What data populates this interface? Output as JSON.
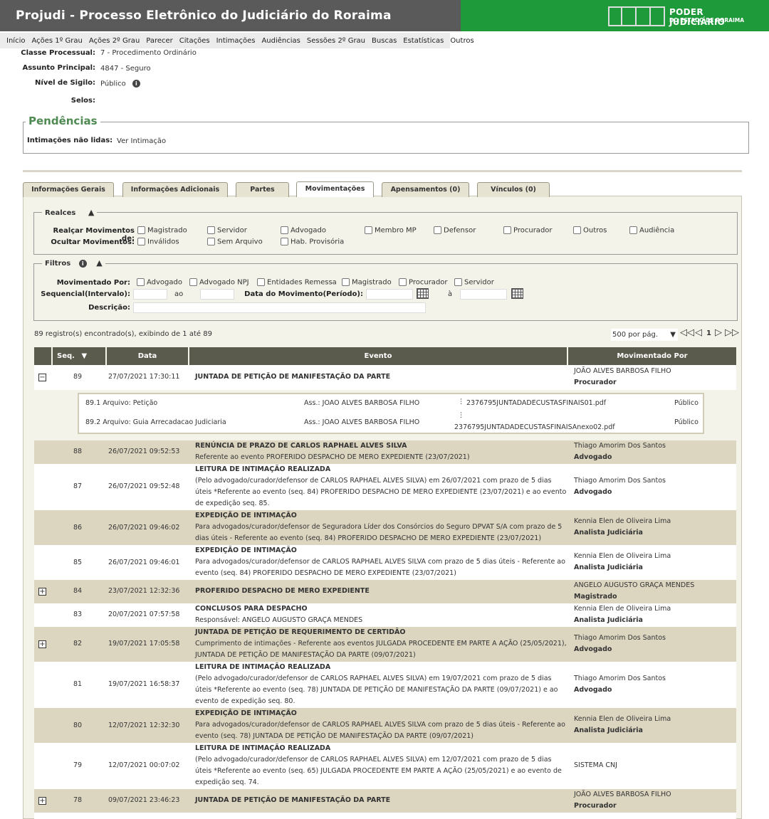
{
  "header": {
    "title": "Projudi - Processo Eletrônico do Judiciário do Roraima",
    "logo_line1": "PODER JUDICIÁRIO",
    "logo_line2": "DO ESTADO DE RORAIMA"
  },
  "menu": [
    "Início",
    "Ações 1º Grau",
    "Ações 2º Grau",
    "Parecer",
    "Citações",
    "Intimações",
    "Audiências",
    "Sessões 2º Grau",
    "Buscas",
    "Estatísticas",
    "Outros"
  ],
  "info": {
    "classe_label": "Classe Processual:",
    "classe_value": "7 - Procedimento Ordinário",
    "assunto_label": "Assunto Principal:",
    "assunto_value": "4847 - Seguro",
    "sigilo_label": "Nível de Sigilo:",
    "sigilo_value": "Público",
    "selos_label": "Selos:"
  },
  "pendencias": {
    "title": "Pendências",
    "label": "Intimações não lidas:",
    "link_ver": "Ver",
    "link_text": "Intimação"
  },
  "tabs": [
    "Informações Gerais",
    "Informações Adicionais",
    "Partes",
    "Movimentações",
    "Apensamentos (0)",
    "Vínculos (0)"
  ],
  "realces": {
    "legend": "Realces",
    "realcar_label": "Realçar Movimentos de:",
    "realcar_options": [
      "Magistrado",
      "Servidor",
      "Advogado",
      "Membro MP",
      "Defensor",
      "Procurador",
      "Outros",
      "Audiência"
    ],
    "ocultar_label": "Ocultar Movimentos:",
    "ocultar_options": [
      "Inválidos",
      "Sem Arquivo",
      "Hab. Provisória"
    ]
  },
  "filtros": {
    "legend": "Filtros",
    "mov_por_label": "Movimentado Por:",
    "mov_por_options": [
      "Advogado",
      "Advogado NPJ",
      "Entidades Remessa",
      "Magistrado",
      "Procurador",
      "Servidor"
    ],
    "seq_label": "Sequencial(Intervalo):",
    "ao": "ao",
    "data_label": "Data do Movimento(Período):",
    "a": "à",
    "descricao_label": "Descrição:"
  },
  "results": {
    "summary": "89 registro(s) encontrado(s), exibindo de 1 até 89",
    "per_page": "500 por pág.",
    "page": "1"
  },
  "table": {
    "headers": [
      "Seq.",
      "Data",
      "Evento",
      "Movimentado Por"
    ],
    "rows": [
      {
        "seq": "89",
        "date": "27/07/2021 17:30:11",
        "title": "JUNTADA DE PETIÇÃO DE MANIFESTAÇÃO DA PARTE",
        "desc": "",
        "by": "JOÃO ALVES BARBOSA FILHO",
        "role": "Procurador"
      },
      {
        "seq": "88",
        "date": "26/07/2021 09:52:53",
        "title": "RENÚNCIA DE PRAZO DE CARLOS RAPHAEL ALVES SILVA",
        "desc": "Referente ao evento PROFERIDO DESPACHO DE MERO EXPEDIENTE (23/07/2021)",
        "by": "Thiago Amorim Dos Santos",
        "role": "Advogado"
      },
      {
        "seq": "87",
        "date": "26/07/2021 09:52:48",
        "title": "LEITURA DE INTIMAÇÃO REALIZADA",
        "desc": "(Pelo advogado/curador/defensor de CARLOS RAPHAEL ALVES SILVA) em 26/07/2021 com prazo de 5 dias úteis *Referente ao evento (seq. 84) PROFERIDO DESPACHO DE MERO EXPEDIENTE (23/07/2021) e ao evento de expedição seq. 85.",
        "by": "Thiago Amorim Dos Santos",
        "role": "Advogado"
      },
      {
        "seq": "86",
        "date": "26/07/2021 09:46:02",
        "title": "EXPEDIÇÃO DE INTIMAÇÃO",
        "desc": "Para advogados/curador/defensor de Seguradora Líder dos Consórcios do Seguro DPVAT S/A com prazo de 5 dias úteis - Referente ao evento (seq. 84) PROFERIDO DESPACHO DE MERO EXPEDIENTE (23/07/2021)",
        "by": "Kennia Elen de Oliveira Lima",
        "role": "Analista Judiciária"
      },
      {
        "seq": "85",
        "date": "26/07/2021 09:46:01",
        "title": "EXPEDIÇÃO DE INTIMAÇÃO",
        "desc": "Para advogados/curador/defensor de CARLOS RAPHAEL ALVES SILVA com prazo de 5 dias úteis - Referente ao evento (seq. 84) PROFERIDO DESPACHO DE MERO EXPEDIENTE (23/07/2021)",
        "by": "Kennia Elen de Oliveira Lima",
        "role": "Analista Judiciária"
      },
      {
        "seq": "84",
        "date": "23/07/2021 12:32:36",
        "title": "PROFERIDO DESPACHO DE MERO EXPEDIENTE",
        "desc": "",
        "by": "ANGELO AUGUSTO GRAÇA MENDES",
        "role": "Magistrado"
      },
      {
        "seq": "83",
        "date": "20/07/2021 07:57:58",
        "title": "CONCLUSOS PARA DESPACHO",
        "desc": "Responsável: ANGELO AUGUSTO GRAÇA MENDES",
        "by": "Kennia Elen de Oliveira Lima",
        "role": "Analista Judiciária"
      },
      {
        "seq": "82",
        "date": "19/07/2021 17:05:58",
        "title": "JUNTADA DE PETIÇÃO DE REQUERIMENTO DE CERTIDÃO",
        "desc": "Cumprimento de intimações - Referente aos eventos JULGADA PROCEDENTE EM PARTE A AÇÃO (25/05/2021), JUNTADA DE PETIÇÃO DE MANIFESTAÇÃO DA PARTE (09/07/2021)",
        "by": "Thiago Amorim Dos Santos",
        "role": "Advogado"
      },
      {
        "seq": "81",
        "date": "19/07/2021 16:58:37",
        "title": "LEITURA DE INTIMAÇÃO REALIZADA",
        "desc": "(Pelo advogado/curador/defensor de CARLOS RAPHAEL ALVES SILVA) em 19/07/2021 com prazo de 5 dias úteis *Referente ao evento (seq. 78) JUNTADA DE PETIÇÃO DE MANIFESTAÇÃO DA PARTE (09/07/2021) e ao evento de expedição seq. 80.",
        "by": "Thiago Amorim Dos Santos",
        "role": "Advogado"
      },
      {
        "seq": "80",
        "date": "12/07/2021 12:32:30",
        "title": "EXPEDIÇÃO DE INTIMAÇÃO",
        "desc": "Para advogados/curador/defensor de CARLOS RAPHAEL ALVES SILVA com prazo de 5 dias úteis - Referente ao evento (seq. 78) JUNTADA DE PETIÇÃO DE MANIFESTAÇÃO DA PARTE (09/07/2021)",
        "by": "Kennia Elen de Oliveira Lima",
        "role": "Analista Judiciária"
      },
      {
        "seq": "79",
        "date": "12/07/2021 00:07:02",
        "title": "LEITURA DE INTIMAÇÃO REALIZADA",
        "desc": "(Pelo advogado/curador/defensor de CARLOS RAPHAEL ALVES SILVA) em 12/07/2021 com prazo de 5 dias úteis *Referente ao evento (seq. 65) JULGADA PROCEDENTE EM PARTE A AÇÃO (25/05/2021) e ao evento de expedição seq. 74.",
        "by": "SISTEMA CNJ",
        "role": ""
      },
      {
        "seq": "78",
        "date": "09/07/2021 23:46:23",
        "title": "JUNTADA DE PETIÇÃO DE MANIFESTAÇÃO DA PARTE",
        "desc": "",
        "by": "JOÃO ALVES BARBOSA FILHO",
        "role": "Procurador"
      }
    ],
    "files": [
      {
        "id": "89.1",
        "arquivo": "Arquivo: Petição",
        "ass": "Ass.: JOAO ALVES BARBOSA FILHO",
        "file": "2376795JUNTADADECUSTASFINAIS01.pdf",
        "nivel": "Público"
      },
      {
        "id": "89.2",
        "arquivo": "Arquivo: Guia Arrecadacao Judiciaria",
        "ass": "Ass.: JOAO ALVES BARBOSA FILHO",
        "file": "2376795JUNTADADECUSTASFINAISAnexo02.pdf",
        "nivel": "Público"
      }
    ]
  }
}
